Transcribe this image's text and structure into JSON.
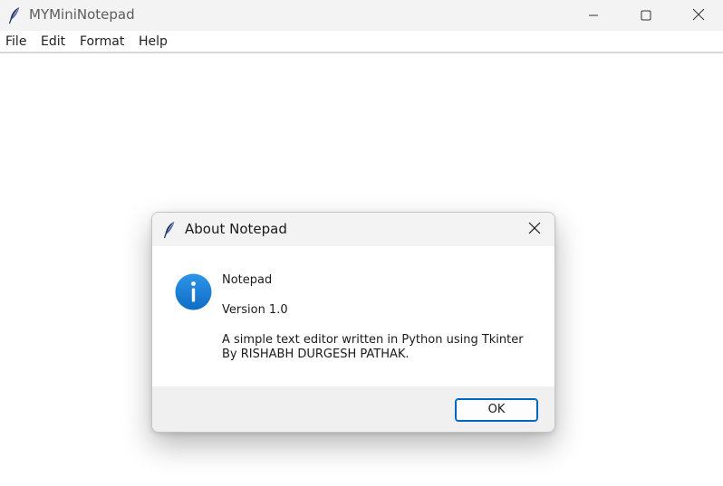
{
  "window": {
    "title": "MYMiniNotepad",
    "icons": {
      "app": "feather-icon",
      "minimize": "minimize-icon",
      "maximize": "maximize-icon",
      "close": "close-icon"
    }
  },
  "menubar": {
    "items": [
      {
        "label": "File"
      },
      {
        "label": "Edit"
      },
      {
        "label": "Format"
      },
      {
        "label": "Help"
      }
    ]
  },
  "editor": {
    "content": ""
  },
  "dialog": {
    "title": "About Notepad",
    "icon": "info-icon",
    "heading": "Notepad",
    "version": "Version 1.0",
    "description": "A simple text editor written in Python using Tkinter",
    "author": "By RISHABH DURGESH PATHAK.",
    "ok_label": "OK"
  },
  "colors": {
    "titlebar_bg": "#f3f3f3",
    "info_blue": "#1a7fd6",
    "ok_border": "#0067c0",
    "footer_bg": "#f0f0f0"
  }
}
